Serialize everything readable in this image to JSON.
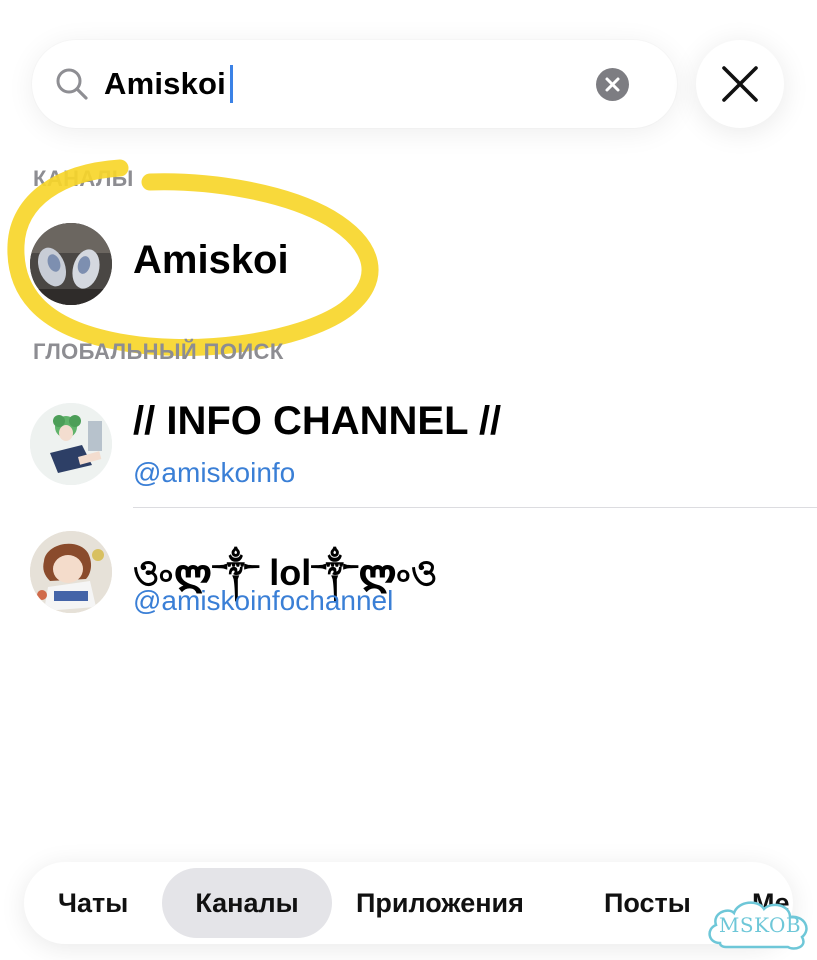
{
  "search": {
    "query": "Amiskoi",
    "clear_icon": "clear-circle-icon",
    "close_icon": "close-x-icon"
  },
  "sections": {
    "channels_header": "КАНАЛЫ",
    "global_header": "ГЛОБАЛЬНЫЙ ПОИСК"
  },
  "channel_result": {
    "title": "Amiskoi"
  },
  "global_results": [
    {
      "title": "// INFO CHANNEL //",
      "handle": "@amiskoinfo"
    },
    {
      "title": "ও৹ლ༒ lol༒ლ৹ও",
      "handle": "@amiskoinfochannel"
    }
  ],
  "tabs": [
    {
      "label": "Чаты",
      "active": false
    },
    {
      "label": "Каналы",
      "active": true
    },
    {
      "label": "Приложения",
      "active": false
    },
    {
      "label": "Посты",
      "active": false
    },
    {
      "label": "Ме",
      "active": false
    }
  ],
  "watermark": "MSKOB",
  "colors": {
    "accent": "#3a7fd6",
    "caret": "#3b82e6",
    "highlight": "#f7d62a",
    "section_header": "#8d8d92"
  }
}
